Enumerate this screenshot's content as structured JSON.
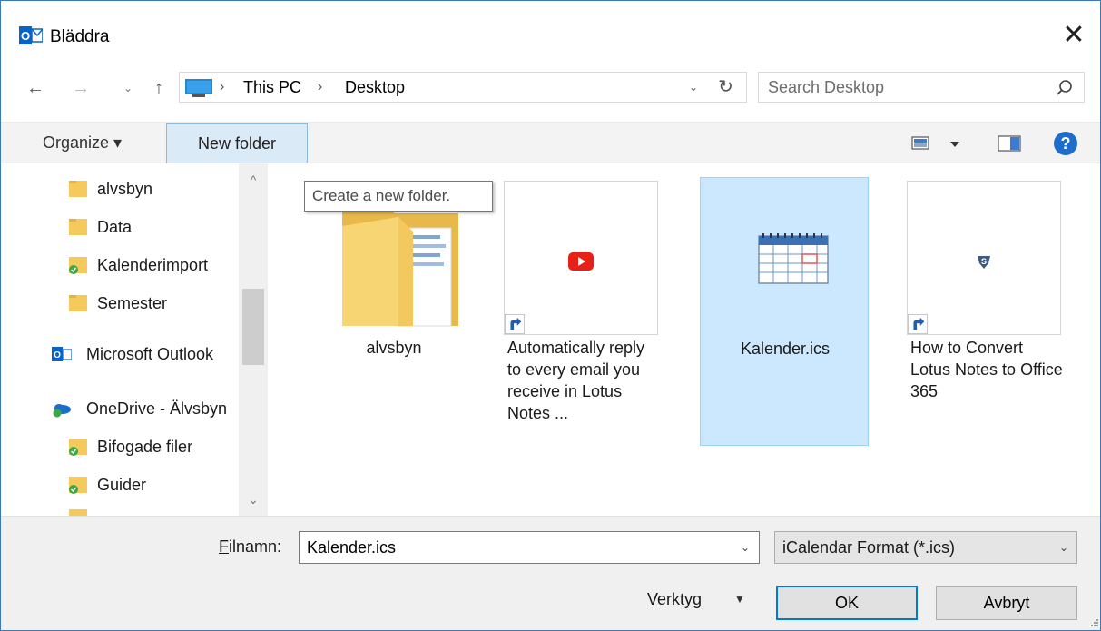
{
  "window": {
    "title": "Bläddra",
    "close_glyph": "✕",
    "accent": "#0078d7"
  },
  "nav": {
    "back_glyph": "←",
    "forward_glyph": "→",
    "recent_glyph": "⌄",
    "up_glyph": "↑",
    "address": {
      "segments": [
        "This PC",
        "Desktop"
      ],
      "separator": "›",
      "dropdown_glyph": "⌄",
      "refresh_glyph": "↻"
    },
    "search": {
      "placeholder": "Search Desktop"
    }
  },
  "toolbar": {
    "organize_label": "Organize ▾",
    "new_folder_label": "New folder",
    "view_arrow": "▾",
    "help_glyph": "?"
  },
  "tooltip": {
    "text": "Create a new folder."
  },
  "navpane": {
    "items": [
      {
        "label": "alvsbyn",
        "icon": "folder-icon"
      },
      {
        "label": "Data",
        "icon": "folder-icon"
      },
      {
        "label": "Kalenderimport",
        "icon": "folder-synced-icon"
      },
      {
        "label": "Semester",
        "icon": "folder-icon"
      },
      {
        "label": "Microsoft Outlook",
        "icon": "outlook-icon"
      },
      {
        "label": "OneDrive - Älvsbyn",
        "icon": "onedrive-icon"
      },
      {
        "label": "Bifogade filer",
        "icon": "folder-synced-icon"
      },
      {
        "label": "Guider",
        "icon": "folder-synced-icon"
      }
    ],
    "scroll_up_glyph": "^",
    "scroll_down_glyph": "⌄"
  },
  "files": [
    {
      "name": "alvsbyn",
      "icon": "folder-icon",
      "selected": false
    },
    {
      "name": "Automatically reply to every email you receive in Lotus Notes ...",
      "icon": "youtube-shortcut-icon",
      "selected": false
    },
    {
      "name": "Kalender.ics",
      "icon": "calendar-file-icon",
      "selected": true
    },
    {
      "name": "How to Convert Lotus Notes to Office 365",
      "icon": "shortcut-icon",
      "selected": false
    }
  ],
  "bottom": {
    "filename_label_key": "F",
    "filename_label_rest": "ilnamn:",
    "filename_value": "Kalender.ics",
    "filename_arrow": "⌄",
    "filetype_value": "iCalendar Format (*.ics)",
    "filetype_arrow": "⌄",
    "tools_key": "V",
    "tools_rest": "erktyg",
    "tools_arrow": "▼",
    "ok_label": "OK",
    "cancel_label": "Avbryt"
  }
}
